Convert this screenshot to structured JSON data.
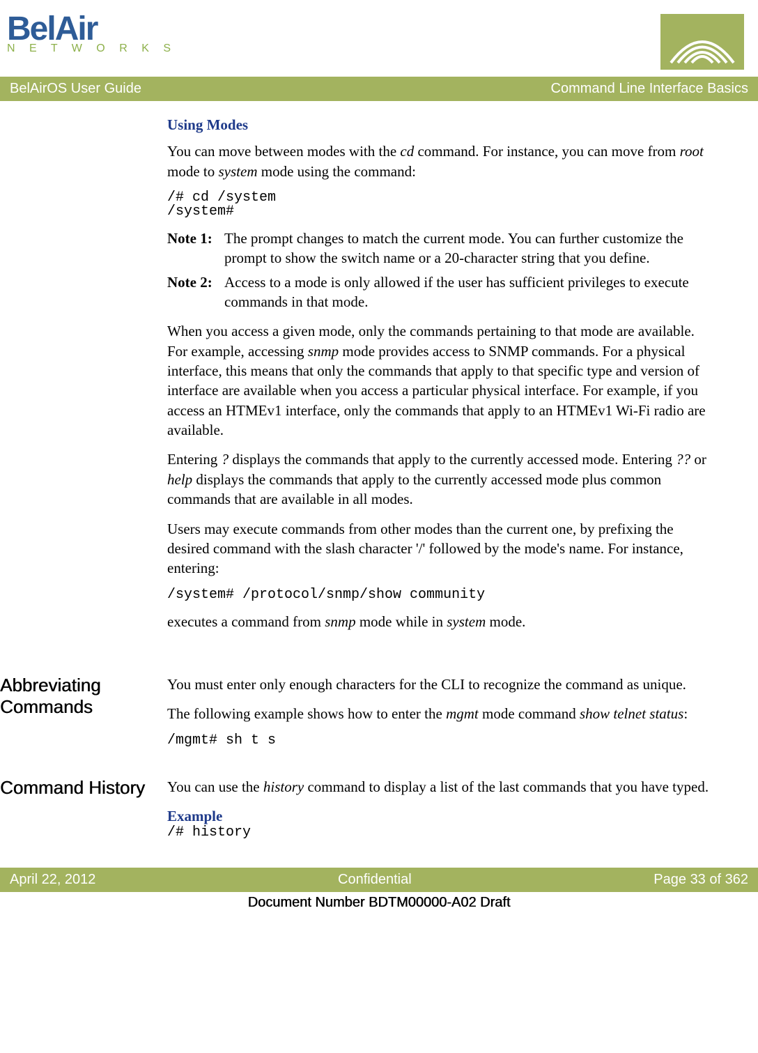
{
  "logo": {
    "text1": "BelAir",
    "text2": "N E T W O R K S"
  },
  "titlebar": {
    "left": "BelAirOS User Guide",
    "right": "Command Line Interface Basics"
  },
  "sections": {
    "using_modes": {
      "heading": "Using Modes",
      "p1_a": "You can move between modes with the ",
      "p1_cd": "cd",
      "p1_b": " command. For instance, you can move from ",
      "p1_root": "root",
      "p1_c": " mode to ",
      "p1_system": "system",
      "p1_d": " mode using the command:",
      "code1": "/# cd /system\n/system#",
      "note1_label": "Note 1:",
      "note1_text": "The prompt changes to match the current mode. You can further customize the prompt to show the switch name or a 20-character string that you define.",
      "note2_label": "Note 2:",
      "note2_text": "Access to a mode is only allowed if the user has sufficient privileges to execute commands in that mode.",
      "p2_a": "When you access a given mode, only the commands pertaining to that mode are available. For example, accessing ",
      "p2_snmp": "snmp",
      "p2_b": " mode provides access to SNMP commands. For a physical interface, this means that only the commands that apply to that specific type and version of interface are available when you access a particular physical interface. For example, if you access an HTMEv1 interface, only the commands that apply to an HTMEv1 Wi-Fi radio are available.",
      "p3_a": "Entering ",
      "p3_q": "?",
      "p3_b": " displays the commands that apply to the currently accessed mode. Entering ",
      "p3_qq": "??",
      "p3_c": " or ",
      "p3_help": "help",
      "p3_d": " displays the commands that apply to the currently accessed mode plus common commands that are available in all modes.",
      "p4": "Users may execute commands from other modes than the current one, by prefixing the desired command with the slash character '/' followed by the mode's name. For instance, entering:",
      "code2": "/system# /protocol/snmp/show community",
      "p5_a": "executes a command from ",
      "p5_snmp": "snmp",
      "p5_b": " mode while in ",
      "p5_system": "system",
      "p5_c": " mode."
    },
    "abbrev": {
      "side_heading": "Abbreviating Commands",
      "p1": "You must enter only enough characters for the CLI to recognize the command as unique.",
      "p2_a": "The following example shows how to enter the ",
      "p2_mgmt": "mgmt",
      "p2_b": " mode command ",
      "p2_cmd": "show telnet status",
      "p2_c": ":",
      "code": "/mgmt# sh t s"
    },
    "history": {
      "side_heading": "Command History",
      "p1_a": "You can use the ",
      "p1_history": "history",
      "p1_b": " command to display a list of the last commands that you have typed.",
      "example_label": "Example",
      "code": "/# history"
    }
  },
  "footer": {
    "left": "April 22, 2012",
    "center": "Confidential",
    "right": "Page 33 of 362",
    "doc_number": "Document Number BDTM00000-A02 Draft"
  }
}
